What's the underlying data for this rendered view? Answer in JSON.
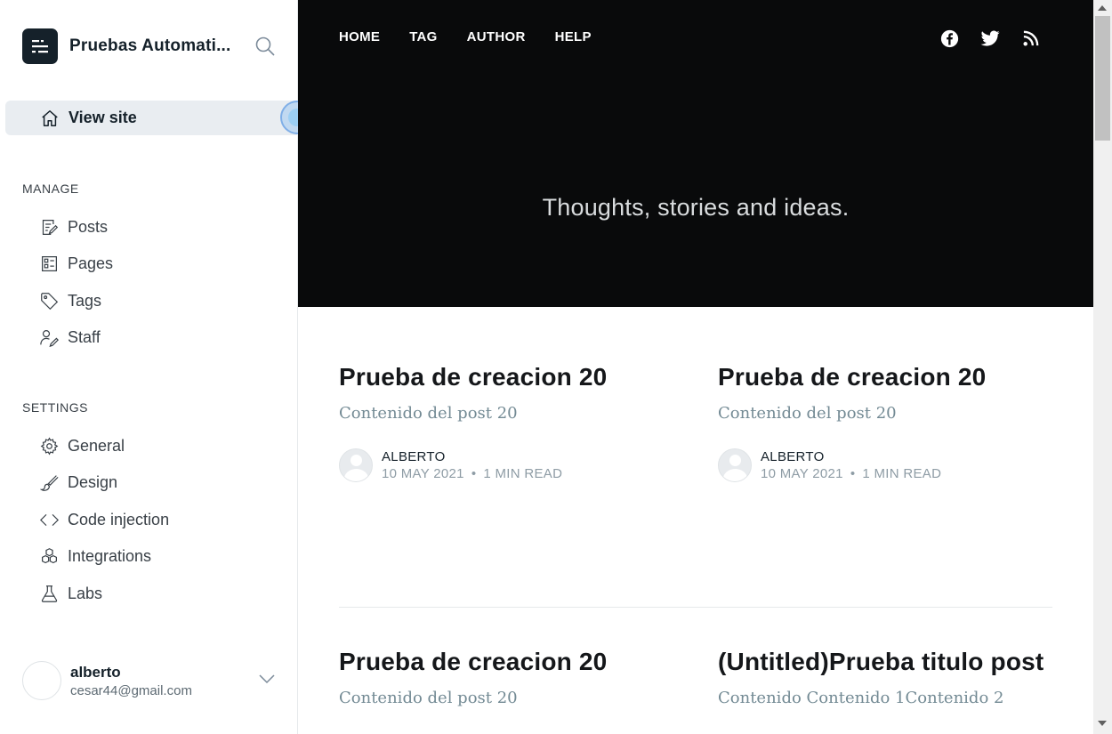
{
  "sidebar": {
    "brand_title": "Pruebas Automati...",
    "view_site": "View site",
    "manage_heading": "MANAGE",
    "manage_items": [
      {
        "label": "Posts",
        "icon": "posts-icon"
      },
      {
        "label": "Pages",
        "icon": "pages-icon"
      },
      {
        "label": "Tags",
        "icon": "tag-icon"
      },
      {
        "label": "Staff",
        "icon": "staff-icon"
      }
    ],
    "settings_heading": "SETTINGS",
    "settings_items": [
      {
        "label": "General",
        "icon": "gear-icon"
      },
      {
        "label": "Design",
        "icon": "brush-icon"
      },
      {
        "label": "Code injection",
        "icon": "code-icon"
      },
      {
        "label": "Integrations",
        "icon": "integrations-icon"
      },
      {
        "label": "Labs",
        "icon": "flask-icon"
      }
    ],
    "user": {
      "name": "alberto",
      "email": "cesar44@gmail.com"
    }
  },
  "site": {
    "nav": [
      "HOME",
      "TAG",
      "AUTHOR",
      "HELP"
    ],
    "social": [
      "facebook-icon",
      "twitter-icon",
      "rss-icon"
    ],
    "tagline": "Thoughts, stories and ideas.",
    "posts": [
      {
        "title": "Prueba de creacion 20",
        "excerpt": "Contenido del post 20",
        "author": "ALBERTO",
        "date": "10 MAY 2021",
        "read_time": "1 MIN READ"
      },
      {
        "title": "Prueba de creacion 20",
        "excerpt": "Contenido del post 20",
        "author": "ALBERTO",
        "date": "10 MAY 2021",
        "read_time": "1 MIN READ"
      },
      {
        "title": "Prueba de creacion 20",
        "excerpt": "Contenido del post 20"
      },
      {
        "title": "(Untitled)Prueba titulo post",
        "excerpt": "Contenido Contenido 1Contenido 2"
      }
    ],
    "meta_separator": "•"
  },
  "colors": {
    "hero_bg": "#090a0b",
    "sidebar_active_bg": "#e9edf1",
    "text_dark": "#15212a",
    "excerpt": "#738a94"
  }
}
